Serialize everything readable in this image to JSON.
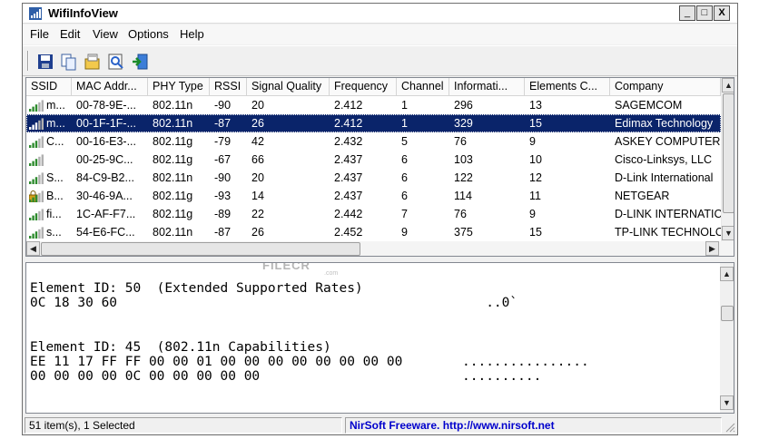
{
  "window": {
    "title": "WifiInfoView"
  },
  "window_controls": {
    "minimize": "_",
    "maximize": "□",
    "close": "X"
  },
  "menu": [
    "File",
    "Edit",
    "View",
    "Options",
    "Help"
  ],
  "toolbar": [
    "save-icon",
    "copy-icon",
    "properties-icon",
    "html-report-icon",
    "exit-icon"
  ],
  "columns": [
    "SSID",
    "MAC Addr...",
    "PHY Type",
    "RSSI",
    "Signal Quality",
    "Frequency",
    "Channel",
    "Informati...",
    "Elements C...",
    "Company"
  ],
  "rows": [
    {
      "ssid": "m...",
      "mac": "00-78-9E-...",
      "phy": "802.11n",
      "rssi": "-90",
      "quality": "20",
      "freq": "2.412",
      "channel": "1",
      "info": "296",
      "elements": "13",
      "company": "SAGEMCOM",
      "icon": "signal-icon",
      "selected": false
    },
    {
      "ssid": "m...",
      "mac": "00-1F-1F-...",
      "phy": "802.11n",
      "rssi": "-87",
      "quality": "26",
      "freq": "2.412",
      "channel": "1",
      "info": "329",
      "elements": "15",
      "company": "Edimax Technology",
      "icon": "signal-icon",
      "selected": true
    },
    {
      "ssid": "C...",
      "mac": "00-16-E3-...",
      "phy": "802.11g",
      "rssi": "-79",
      "quality": "42",
      "freq": "2.432",
      "channel": "5",
      "info": "76",
      "elements": "9",
      "company": "ASKEY COMPUTER C",
      "icon": "signal-icon",
      "selected": false
    },
    {
      "ssid": "",
      "mac": "00-25-9C...",
      "phy": "802.11g",
      "rssi": "-67",
      "quality": "66",
      "freq": "2.437",
      "channel": "6",
      "info": "103",
      "elements": "10",
      "company": "Cisco-Linksys, LLC",
      "icon": "signal-icon",
      "selected": false
    },
    {
      "ssid": "S...",
      "mac": "84-C9-B2...",
      "phy": "802.11n",
      "rssi": "-90",
      "quality": "20",
      "freq": "2.437",
      "channel": "6",
      "info": "122",
      "elements": "12",
      "company": "D-Link International",
      "icon": "signal-icon",
      "selected": false
    },
    {
      "ssid": "B...",
      "mac": "30-46-9A...",
      "phy": "802.11g",
      "rssi": "-93",
      "quality": "14",
      "freq": "2.437",
      "channel": "6",
      "info": "114",
      "elements": "11",
      "company": "NETGEAR",
      "icon": "lock-signal-icon",
      "selected": false
    },
    {
      "ssid": "fi...",
      "mac": "1C-AF-F7...",
      "phy": "802.11g",
      "rssi": "-89",
      "quality": "22",
      "freq": "2.442",
      "channel": "7",
      "info": "76",
      "elements": "9",
      "company": "D-LINK INTERNATIC",
      "icon": "signal-icon",
      "selected": false
    },
    {
      "ssid": "s...",
      "mac": "54-E6-FC...",
      "phy": "802.11n",
      "rssi": "-87",
      "quality": "26",
      "freq": "2.452",
      "channel": "9",
      "info": "375",
      "elements": "15",
      "company": "TP-LINK TECHNOLO",
      "icon": "signal-icon",
      "selected": false
    }
  ],
  "watermark": {
    "text": "FILECR",
    "sub": ".com"
  },
  "lower_pane": {
    "lines": [
      {
        "hex": "Element ID: 50  (Extended Supported Rates)",
        "ascii": ""
      },
      {
        "hex": "0C 18 30 60",
        "ascii": "   ..0`"
      },
      {
        "hex": "",
        "ascii": ""
      },
      {
        "hex": "",
        "ascii": ""
      },
      {
        "hex": "Element ID: 45  (802.11n Capabilities)",
        "ascii": ""
      },
      {
        "hex": "EE 11 17 FF FF 00 00 01 00 00 00 00 00 00 00 00",
        "ascii": "................"
      },
      {
        "hex": "00 00 00 00 0C 00 00 00 00 00",
        "ascii": ".........."
      }
    ]
  },
  "status": {
    "count": "51 item(s), 1 Selected",
    "link": "NirSoft Freeware.  http://www.nirsoft.net"
  }
}
